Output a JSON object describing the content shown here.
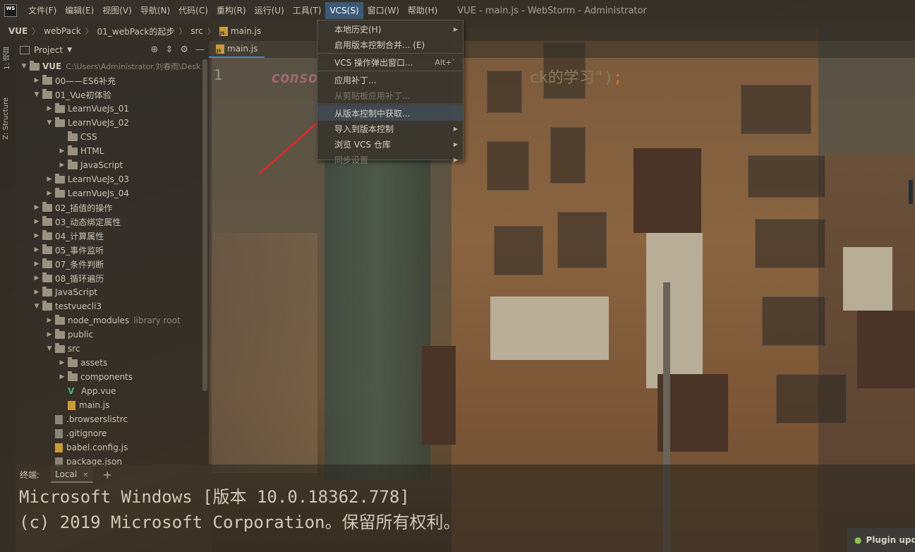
{
  "window": {
    "app_logo": "WS",
    "title": "VUE - main.js - WebStorm - Administrator",
    "menu": [
      "文件(F)",
      "编辑(E)",
      "视图(V)",
      "导航(N)",
      "代码(C)",
      "重构(R)",
      "运行(U)",
      "工具(T)",
      "VCS(S)",
      "窗口(W)",
      "帮助(H)"
    ],
    "active_menu_index": 8
  },
  "breadcrumb": [
    "VUE",
    "webPack",
    "01_webPack的起步",
    "src",
    "main.js"
  ],
  "toolstrip": {
    "project_tab": "1: 项目",
    "structure_tab": "Z: Structure"
  },
  "project_panel": {
    "title": "Project",
    "tree": [
      {
        "label": "VUE",
        "hint": "C:\\Users\\Administrator.刘春雨\\Desk",
        "depth": 0,
        "kind": "folder",
        "open": true,
        "bold": true
      },
      {
        "label": "00——ES6补充",
        "depth": 1,
        "kind": "folder",
        "open": false
      },
      {
        "label": "01_Vue初体验",
        "depth": 1,
        "kind": "folder",
        "open": true
      },
      {
        "label": "LearnVueJs_01",
        "depth": 2,
        "kind": "folder",
        "open": false
      },
      {
        "label": "LearnVueJs_02",
        "depth": 2,
        "kind": "folder",
        "open": true
      },
      {
        "label": "CSS",
        "depth": 3,
        "kind": "folder",
        "leaf": true
      },
      {
        "label": "HTML",
        "depth": 3,
        "kind": "folder",
        "open": false
      },
      {
        "label": "JavaScript",
        "depth": 3,
        "kind": "folder",
        "open": false
      },
      {
        "label": "LearnVueJs_03",
        "depth": 2,
        "kind": "folder",
        "open": false
      },
      {
        "label": "LearnVueJs_04",
        "depth": 2,
        "kind": "folder",
        "open": false
      },
      {
        "label": "02_插值的操作",
        "depth": 1,
        "kind": "folder",
        "open": false
      },
      {
        "label": "03_动态绑定属性",
        "depth": 1,
        "kind": "folder",
        "open": false
      },
      {
        "label": "04_计算属性",
        "depth": 1,
        "kind": "folder",
        "open": false
      },
      {
        "label": "05_事件监听",
        "depth": 1,
        "kind": "folder",
        "open": false
      },
      {
        "label": "07_条件判断",
        "depth": 1,
        "kind": "folder",
        "open": false
      },
      {
        "label": "08_循环遍历",
        "depth": 1,
        "kind": "folder",
        "open": false
      },
      {
        "label": "JavaScript",
        "depth": 1,
        "kind": "folder",
        "open": false
      },
      {
        "label": "testvuecli3",
        "depth": 1,
        "kind": "folder",
        "open": true
      },
      {
        "label": "node_modules",
        "hint": "library root",
        "depth": 2,
        "kind": "folder",
        "open": false
      },
      {
        "label": "public",
        "depth": 2,
        "kind": "folder",
        "open": false
      },
      {
        "label": "src",
        "depth": 2,
        "kind": "folder",
        "open": true
      },
      {
        "label": "assets",
        "depth": 3,
        "kind": "folder",
        "open": false
      },
      {
        "label": "components",
        "depth": 3,
        "kind": "folder",
        "open": false
      },
      {
        "label": "App.vue",
        "depth": 3,
        "kind": "vue",
        "leaf": true
      },
      {
        "label": "main.js",
        "depth": 3,
        "kind": "js",
        "leaf": true
      },
      {
        "label": ".browserslistrc",
        "depth": 2,
        "kind": "file",
        "leaf": true
      },
      {
        "label": ".gitignore",
        "depth": 2,
        "kind": "file",
        "leaf": true
      },
      {
        "label": "babel.config.js",
        "depth": 2,
        "kind": "js",
        "leaf": true
      },
      {
        "label": "package.json",
        "depth": 2,
        "kind": "file",
        "leaf": true
      }
    ]
  },
  "editor": {
    "tab_label": "main.js",
    "line_number": "1",
    "code_kw": "conso",
    "code_str": "ck的学习\")",
    "code_semi": ";"
  },
  "vcs_menu": {
    "items": [
      {
        "label": "本地历史(H)",
        "submenu": true
      },
      {
        "label": "启用版本控制合并... (E)"
      },
      {
        "sep": true
      },
      {
        "label": "VCS 操作弹出窗口...",
        "shortcut": "Alt+`"
      },
      {
        "sep": true
      },
      {
        "label": "应用补丁..."
      },
      {
        "label": "从剪贴板应用补丁...",
        "disabled": true
      },
      {
        "sep": true
      },
      {
        "label": "从版本控制中获取...",
        "highlight": true
      },
      {
        "label": "导入到版本控制",
        "submenu": true
      },
      {
        "label": "浏览 VCS 仓库",
        "submenu": true
      },
      {
        "label": "同步设置",
        "submenu": true,
        "disabled": true
      }
    ]
  },
  "terminal": {
    "label": "终端:",
    "tab": "Local",
    "lines": [
      "Microsoft Windows [版本 10.0.18362.778]",
      "(c) 2019 Microsoft Corporation。保留所有权利。"
    ]
  },
  "notice": {
    "text": "Plugin upd"
  },
  "colors": {
    "annotation_arrow": "#e0262b",
    "active_menu": "#3c5a78",
    "vue_green": "#41b883",
    "js_badge": "#c99a3a"
  }
}
